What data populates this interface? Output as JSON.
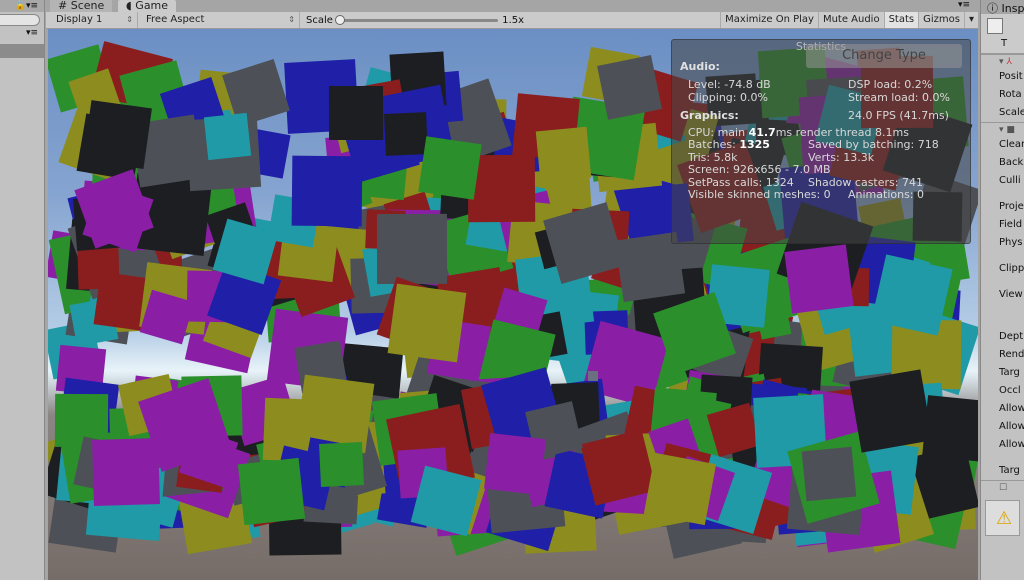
{
  "tabs": {
    "scene": "Scene",
    "game": "Game",
    "scene_icon": "#",
    "game_icon": "pac-man-icon"
  },
  "toolbar": {
    "display": "Display 1",
    "aspect": "Free Aspect",
    "scale_label": "Scale",
    "scale_value": "1.5x",
    "scale_fraction": 0.0,
    "maximize": "Maximize On Play",
    "mute": "Mute Audio",
    "stats": "Stats",
    "gizmos": "Gizmos"
  },
  "stats": {
    "title": "Statistics",
    "change_type": "Change Type",
    "audio": "Audio:",
    "level": "Level: -74.8 dB",
    "clipping": "Clipping: 0.0%",
    "dsp": "DSP load: 0.2%",
    "stream": "Stream load: 0.0%",
    "graphics": "Graphics:",
    "fps": "24.0 FPS (41.7ms)",
    "cpu_a": "CPU: main ",
    "cpu_b": "41.7",
    "cpu_c": "ms  render thread 8.1ms",
    "batches_a": "Batches: ",
    "batches_b": "1325",
    "saved": "Saved by batching: 718",
    "tris": "Tris: 5.8k",
    "verts": "Verts: 13.3k",
    "screen": "Screen: 926x656 - 7.0 MB",
    "setpass": "SetPass calls: 1324",
    "shadow": "Shadow casters: 741",
    "skinned": "Visible skinned meshes: 0",
    "anims": "Animations: 0"
  },
  "inspector": {
    "tab": "Insp",
    "obj_label": "T",
    "fields_transform": [
      "Posit",
      "Rota",
      "Scale"
    ],
    "fields_camera": [
      "Clear",
      "Back",
      "Culli",
      "Proje",
      "Field",
      "Phys",
      "Clipp",
      "View",
      "Dept",
      "Rend",
      "Targ",
      "Occl",
      "Allow",
      "Allow",
      "Allow",
      "Targ"
    ]
  },
  "cube_colors": [
    "#8a1e1e",
    "#2b8f2b",
    "#1f1fa8",
    "#8a1fa6",
    "#8d8d1f",
    "#1f9aa6",
    "#1c1e22",
    "#4d5157"
  ]
}
